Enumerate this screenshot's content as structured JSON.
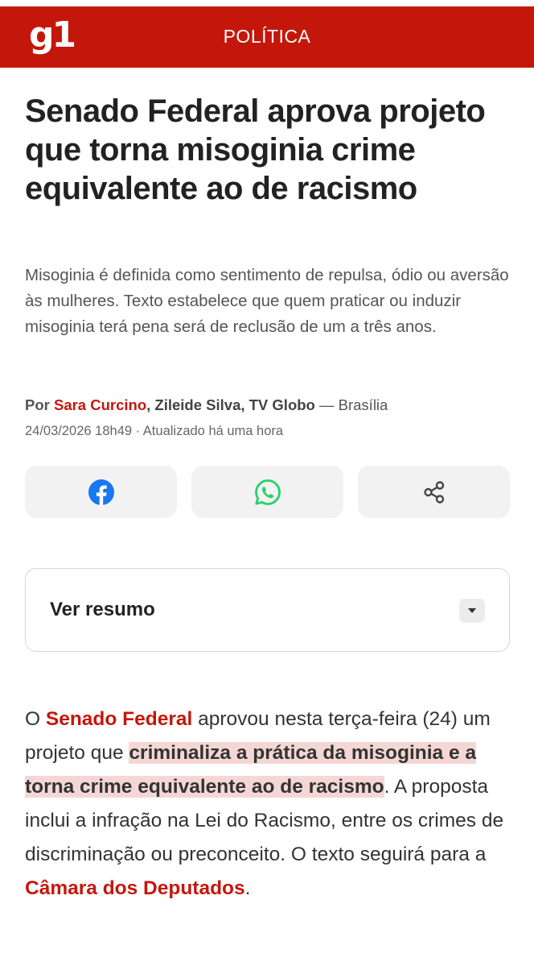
{
  "header": {
    "logo": "g1",
    "section": "POLÍTICA",
    "brand_color": "#c4170c"
  },
  "article": {
    "title": "Senado Federal aprova projeto que torna misoginia crime equivalente ao de racismo",
    "subtitle": "Misoginia é definida como sentimento de repulsa, ódio ou aversão às mulheres. Texto estabelece que quem praticar ou induzir misoginia terá pena será de reclusão de um a três anos.",
    "byline": {
      "prefix": "Por",
      "author_link": "Sara Curcino",
      "authors_rest": ", Zileide Silva, TV Globo",
      "location": " — Brasília"
    },
    "dateline": "24/03/2026 18h49 · Atualizado há uma hora"
  },
  "share": {
    "facebook_icon": "facebook-icon",
    "whatsapp_icon": "whatsapp-icon",
    "share_icon": "share-icon",
    "facebook_color": "#1877f2",
    "whatsapp_color": "#25d366"
  },
  "summary": {
    "label": "Ver resumo",
    "toggle_icon": "chevron-down-icon"
  },
  "body": {
    "p1_start": "O ",
    "p1_link1": "Senado Federal",
    "p1_mid": " aprovou nesta terça-feira (24) um projeto que ",
    "p1_highlight": "criminaliza a prática da misoginia e a torna crime equivalente ao de racismo",
    "p1_mid2": ". A proposta inclui a infração na Lei do Racismo, entre os crimes de discriminação ou preconceito. O texto seguirá para a ",
    "p1_link2": "Câmara dos Deputados",
    "p1_end": "."
  }
}
